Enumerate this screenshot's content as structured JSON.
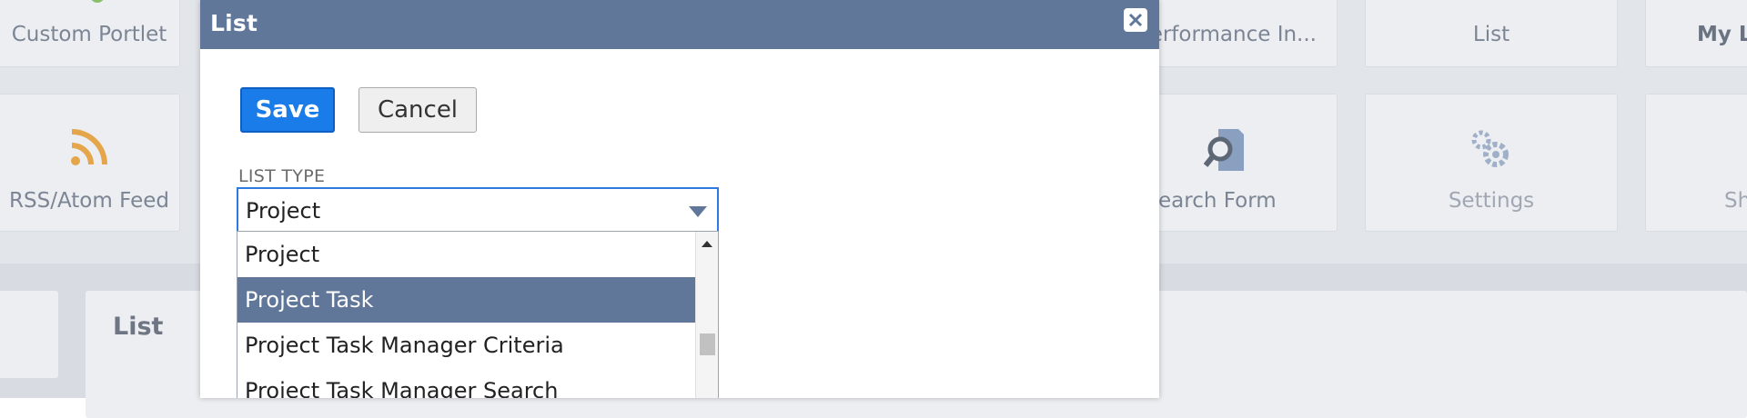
{
  "background": {
    "tiles_row1": [
      {
        "label": "Custom Portlet"
      },
      {
        "label": "erformance In..."
      },
      {
        "label": "List"
      },
      {
        "label": "My Lo"
      }
    ],
    "tiles_row2": [
      {
        "label": "RSS/Atom Feed",
        "icon": "rss-icon"
      },
      {
        "label": "earch Form",
        "icon": "search-form-icon"
      },
      {
        "label": "Settings",
        "icon": "gear-icon"
      },
      {
        "label": "Sh"
      }
    ],
    "lower_card_title": "List"
  },
  "modal": {
    "title": "List",
    "close_icon": "close-icon",
    "save_label": "Save",
    "cancel_label": "Cancel",
    "list_type_label": "LIST TYPE",
    "list_type_value": "Project",
    "options": [
      {
        "label": "Project",
        "selected": false
      },
      {
        "label": "Project Task",
        "selected": true
      },
      {
        "label": "Project Task Manager Criteria",
        "selected": false
      },
      {
        "label": "Project Task Manager Search",
        "selected": false
      }
    ]
  },
  "colors": {
    "header": "#607799",
    "primary_button": "#1a7ce9",
    "selected_option": "#607799",
    "rss_orange": "#e5a54a"
  }
}
